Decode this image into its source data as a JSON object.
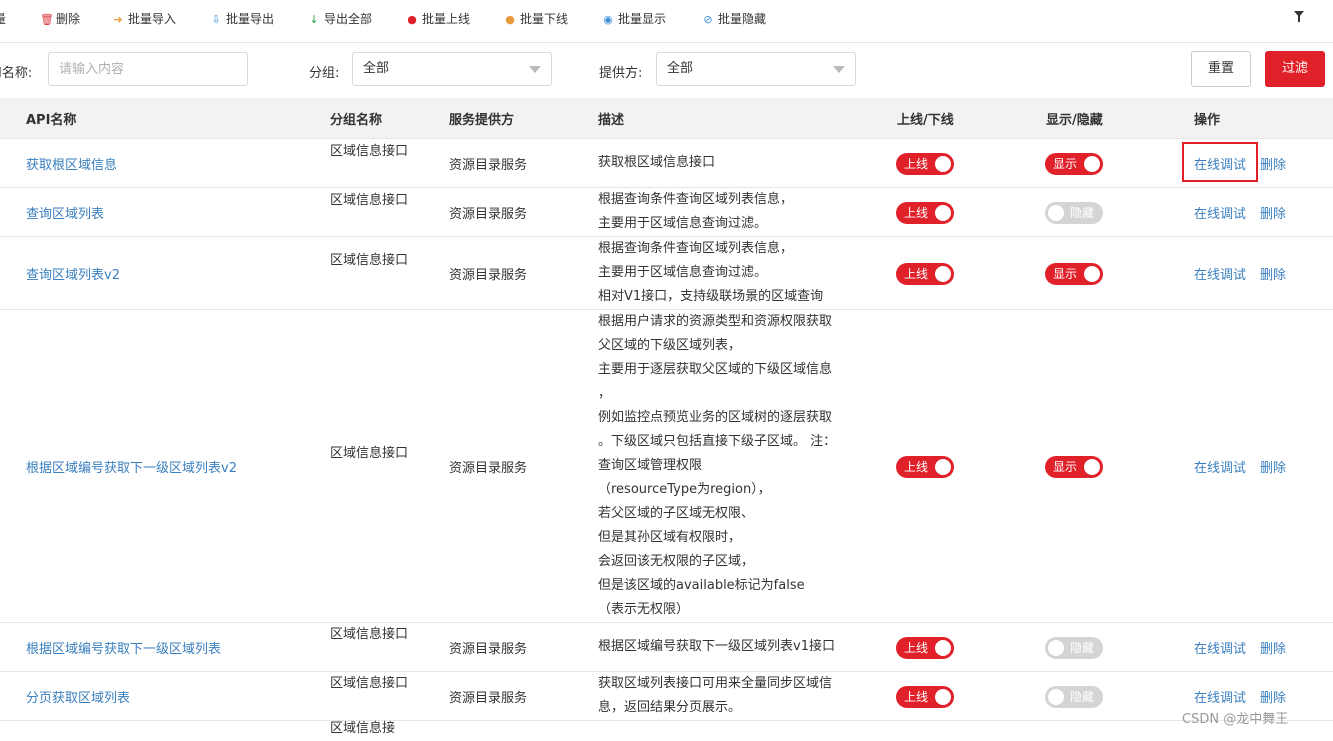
{
  "toolbar": {
    "cut_label": "量",
    "items": [
      {
        "icon": "trash-icon",
        "label": "删除",
        "color": "#d9363e"
      },
      {
        "icon": "import-icon",
        "label": "批量导入",
        "color": "#e89b3c"
      },
      {
        "icon": "export-icon",
        "label": "批量导出",
        "color": "#3a8fd8"
      },
      {
        "icon": "download-icon",
        "label": "导出全部",
        "color": "#2ca44a"
      },
      {
        "icon": "up-circle-icon",
        "label": "批量上线",
        "color": "#e1212a"
      },
      {
        "icon": "down-circle-icon",
        "label": "批量下线",
        "color": "#e89b3c"
      },
      {
        "icon": "eye-icon",
        "label": "批量显示",
        "color": "#3a8fd8"
      },
      {
        "icon": "eye-slash-icon",
        "label": "批量隐藏",
        "color": "#3a8fd8"
      }
    ],
    "filter_icon": "funnel-icon"
  },
  "filter": {
    "api_name_label": "I名称:",
    "api_name_placeholder": "请输入内容",
    "group_label": "分组:",
    "group_value": "全部",
    "provider_label": "提供方:",
    "provider_value": "全部",
    "reset_label": "重置",
    "filter_label": "过滤"
  },
  "colors": {
    "accent": "#e1212a",
    "link": "#3a7fbf",
    "toggle_off": "#d4d4d4"
  },
  "table": {
    "headers": {
      "api": "API名称",
      "group": "分组名称",
      "provider": "服务提供方",
      "desc": "描述",
      "online": "上线/下线",
      "display": "显示/隐藏",
      "action": "操作"
    },
    "rows": [
      {
        "api": "获取根区域信息",
        "group": "区域信息接口",
        "provider": "资源目录服务",
        "desc": "获取根区域信息接口",
        "online": "上线",
        "online_state": "on",
        "display": "显示",
        "display_state": "on",
        "debug": "在线调试",
        "delete": "删除"
      },
      {
        "api": "查询区域列表",
        "group": "区域信息接口",
        "provider": "资源目录服务",
        "desc": "根据查询条件查询区域列表信息，\n主要用于区域信息查询过滤。",
        "online": "上线",
        "online_state": "on",
        "display": "隐藏",
        "display_state": "off",
        "debug": "在线调试",
        "delete": "删除"
      },
      {
        "api": "查询区域列表v2",
        "group": "区域信息接口",
        "provider": "资源目录服务",
        "desc": "根据查询条件查询区域列表信息，\n主要用于区域信息查询过滤。\n相对V1接口，支持级联场景的区域查询",
        "online": "上线",
        "online_state": "on",
        "display": "显示",
        "display_state": "on",
        "debug": "在线调试",
        "delete": "删除"
      },
      {
        "api": "根据区域编号获取下一级区域列表v2",
        "group": "区域信息接口",
        "provider": "资源目录服务",
        "desc": "根据用户请求的资源类型和资源权限获取\n父区域的下级区域列表，\n主要用于逐层获取父区域的下级区域信息\n，\n例如监控点预览业务的区域树的逐层获取\n。下级区域只包括直接下级子区域。 注：\n查询区域管理权限\n（resourceType为region），\n若父区域的子区域无权限、\n但是其孙区域有权限时，\n会返回该无权限的子区域，\n但是该区域的available标记为false\n（表示无权限）",
        "online": "上线",
        "online_state": "on",
        "display": "显示",
        "display_state": "on",
        "debug": "在线调试",
        "delete": "删除"
      },
      {
        "api": "根据区域编号获取下一级区域列表",
        "group": "区域信息接口",
        "provider": "资源目录服务",
        "desc": "根据区域编号获取下一级区域列表v1接口",
        "online": "上线",
        "online_state": "on",
        "display": "隐藏",
        "display_state": "off",
        "debug": "在线调试",
        "delete": "删除"
      },
      {
        "api": "分页获取区域列表",
        "group": "区域信息接口",
        "provider": "资源目录服务",
        "desc": "获取区域列表接口可用来全量同步区域信\n息，返回结果分页展示。",
        "online": "上线",
        "online_state": "on",
        "display": "隐藏",
        "display_state": "off",
        "debug": "在线调试",
        "delete": "删除"
      },
      {
        "api": "",
        "group": "区域信息接",
        "provider": "",
        "desc": ""
      }
    ]
  },
  "watermark": "CSDN @龙中舞王"
}
